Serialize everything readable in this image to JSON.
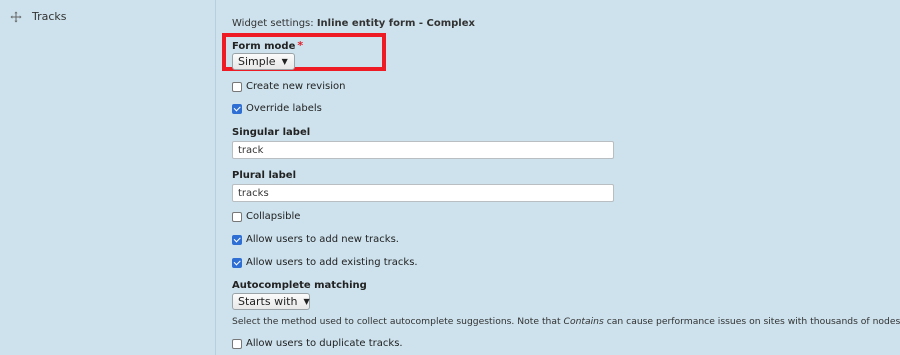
{
  "field": {
    "name": "Tracks",
    "drag_icon": "move-arrows-icon"
  },
  "widget": {
    "prefix": "Widget settings: ",
    "name": "Inline entity form - Complex"
  },
  "form_mode": {
    "label": "Form mode",
    "required_marker": "*",
    "value": "Simple"
  },
  "checkboxes": {
    "create_new_revision": {
      "label": "Create new revision",
      "checked": false
    },
    "override_labels": {
      "label": "Override labels",
      "checked": true
    },
    "collapsible": {
      "label": "Collapsible",
      "checked": false
    },
    "allow_add_new": {
      "label": "Allow users to add new tracks.",
      "checked": true
    },
    "allow_add_existing": {
      "label": "Allow users to add existing tracks.",
      "checked": true
    },
    "allow_duplicate": {
      "label": "Allow users to duplicate tracks.",
      "checked": false
    }
  },
  "singular_label": {
    "label": "Singular label",
    "value": "track"
  },
  "plural_label": {
    "label": "Plural label",
    "value": "tracks"
  },
  "autocomplete": {
    "label": "Autocomplete matching",
    "value": "Starts with",
    "description_before": "Select the method used to collect autocomplete suggestions. Note that ",
    "description_em": "Contains",
    "description_after": " can cause performance issues on sites with thousands of nodes."
  },
  "colors": {
    "background": "#cde2ed",
    "highlight": "#ee1b24",
    "checkbox_checked": "#2f6fd3",
    "required": "#e0202a"
  }
}
